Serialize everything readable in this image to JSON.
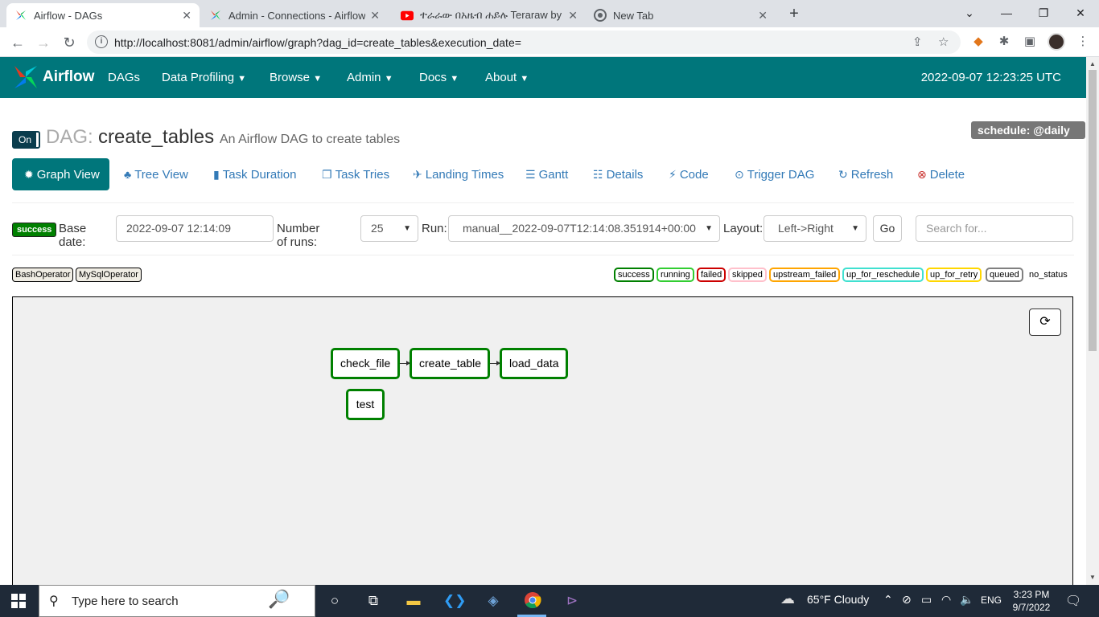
{
  "browser": {
    "tabs": [
      {
        "title": "Airflow - DAGs",
        "favicon": "airflow-icon",
        "active": true
      },
      {
        "title": "Admin - Connections - Airflow",
        "favicon": "airflow-icon",
        "active": false
      },
      {
        "title": "ተራራው በአዜብ ሐይሉ Teraraw by A",
        "favicon": "youtube-icon",
        "active": false
      },
      {
        "title": "New Tab",
        "favicon": "chrome-icon",
        "active": false
      }
    ],
    "url": "http://localhost:8081/admin/airflow/graph?dag_id=create_tables&execution_date="
  },
  "navbar": {
    "brand": "Airflow",
    "items": [
      "DAGs",
      "Data Profiling",
      "Browse",
      "Admin",
      "Docs",
      "About"
    ],
    "time": "2022-09-07 12:23:25 UTC"
  },
  "dag": {
    "toggle": "On",
    "prefix": "DAG:",
    "name": "create_tables",
    "description": "An Airflow DAG to create tables",
    "schedule": "schedule: @daily"
  },
  "views": [
    {
      "label": "Graph View",
      "icon": "asterisk-icon",
      "active": true
    },
    {
      "label": "Tree View",
      "icon": "tree-icon"
    },
    {
      "label": "Task Duration",
      "icon": "bar-chart-icon"
    },
    {
      "label": "Task Tries",
      "icon": "copy-icon"
    },
    {
      "label": "Landing Times",
      "icon": "plane-icon"
    },
    {
      "label": "Gantt",
      "icon": "align-left-icon"
    },
    {
      "label": "Details",
      "icon": "list-icon"
    },
    {
      "label": "Code",
      "icon": "flash-icon"
    },
    {
      "label": "Trigger DAG",
      "icon": "play-circle-icon"
    },
    {
      "label": "Refresh",
      "icon": "refresh-icon"
    },
    {
      "label": "Delete",
      "icon": "remove-circle-icon"
    }
  ],
  "form": {
    "state": "success",
    "base_date_label": "Base date:",
    "base_date": "2022-09-07 12:14:09",
    "num_runs_label": "Number of runs:",
    "num_runs": "25",
    "run_label": "Run:",
    "run": "manual__2022-09-07T12:14:08.351914+00:00",
    "layout_label": "Layout:",
    "layout": "Left->Right",
    "go": "Go",
    "search_placeholder": "Search for..."
  },
  "operators": [
    "BashOperator",
    "MySqlOperator"
  ],
  "statuses": [
    {
      "label": "success",
      "color": "#008000"
    },
    {
      "label": "running",
      "color": "#32cd32"
    },
    {
      "label": "failed",
      "color": "#cc0000"
    },
    {
      "label": "skipped",
      "color": "#ffc0cb"
    },
    {
      "label": "upstream_failed",
      "color": "#ffa500"
    },
    {
      "label": "up_for_reschedule",
      "color": "#40e0d0"
    },
    {
      "label": "up_for_retry",
      "color": "#ffd700"
    },
    {
      "label": "queued",
      "color": "#808080"
    },
    {
      "label": "no_status",
      "color": "#ffffff"
    }
  ],
  "graph": {
    "nodes": [
      "check_file",
      "create_table",
      "load_data",
      "test"
    ]
  },
  "taskbar": {
    "search": "Type here to search",
    "weather": "65°F  Cloudy",
    "lang": "ENG",
    "time": "3:23 PM",
    "date": "9/7/2022"
  }
}
